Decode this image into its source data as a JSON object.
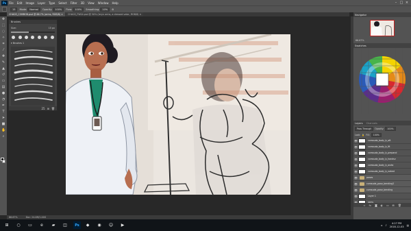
{
  "menubar": {
    "logo": "Ps",
    "items": [
      "File",
      "Edit",
      "Image",
      "Layer",
      "Type",
      "Select",
      "Filter",
      "3D",
      "View",
      "Window",
      "Help"
    ]
  },
  "options": {
    "size_value": "15",
    "mode_label": "Mode:",
    "mode_value": "Normal",
    "opacity_label": "Opacity:",
    "opacity_value": "100%",
    "flow_label": "Flow:",
    "flow_value": "100%",
    "smoothing_label": "Smoothing:",
    "smoothing_value": "10%"
  },
  "tabs": [
    {
      "label": "CH#05_COMBO8.psd @ 66.7% (arms, RGB/8) ×",
      "active": true
    },
    {
      "label": "CH#05_FW04.psd @ 50% (leryn arms, a dressed valor, RGB/8) ×",
      "active": false
    }
  ],
  "brush_panel": {
    "title": "Brushes",
    "size_label": "Size:",
    "size_value": "15 px",
    "folder_label": "Brushes 1",
    "footer_value": "25"
  },
  "status": {
    "zoom": "66.67%",
    "doc": "Doc: 24.0M/1.00G"
  },
  "right_panel": {
    "navigator_tab": "Navigator",
    "zoom_value": "66.67%",
    "color_tabs": [
      "Swatches"
    ],
    "layers_tabs": [
      "Layers",
      "Channels"
    ],
    "blend_mode": "Pass Through",
    "opacity_label": "Opacity:",
    "opacity_value": "100%",
    "lock_label": "Lock:",
    "fill_label": "Fill:",
    "fill_value": "100%",
    "layers": [
      {
        "name": "comsuda_body_b_aft",
        "type": "layer",
        "visible": true
      },
      {
        "name": "comsuda_body_b_lft",
        "type": "layer",
        "visible": true
      },
      {
        "name": "comsuda_body_b_prepand",
        "type": "layer",
        "visible": true
      },
      {
        "name": "comsuda_body_b_handsv",
        "type": "layer",
        "visible": true
      },
      {
        "name": "comsuda_body_b_asrta",
        "type": "layer",
        "visible": true
      },
      {
        "name": "comsuda_body_b_naked",
        "type": "layer",
        "visible": true
      },
      {
        "name": "poses",
        "type": "folder",
        "visible": true
      },
      {
        "name": "comsuda_pose_bending2",
        "type": "folder",
        "visible": true
      },
      {
        "name": "comsuda_pose_bending",
        "type": "folder",
        "visible": true
      },
      {
        "name": "Layer 1",
        "type": "layer",
        "visible": true
      },
      {
        "name": "rams",
        "type": "layer",
        "visible": true
      },
      {
        "name": "bg",
        "type": "image",
        "visible": true
      }
    ]
  },
  "taskbar": {
    "time": "4:27 PM",
    "date": "2018-12-03"
  },
  "colors": {
    "ui_dark": "#282828",
    "ui_panel": "#535353",
    "selection": "#c02020",
    "coat": "#eef1f6",
    "scrubs": "#1f8c6e",
    "skin": "#b36a4c",
    "hair": "#201c24"
  }
}
